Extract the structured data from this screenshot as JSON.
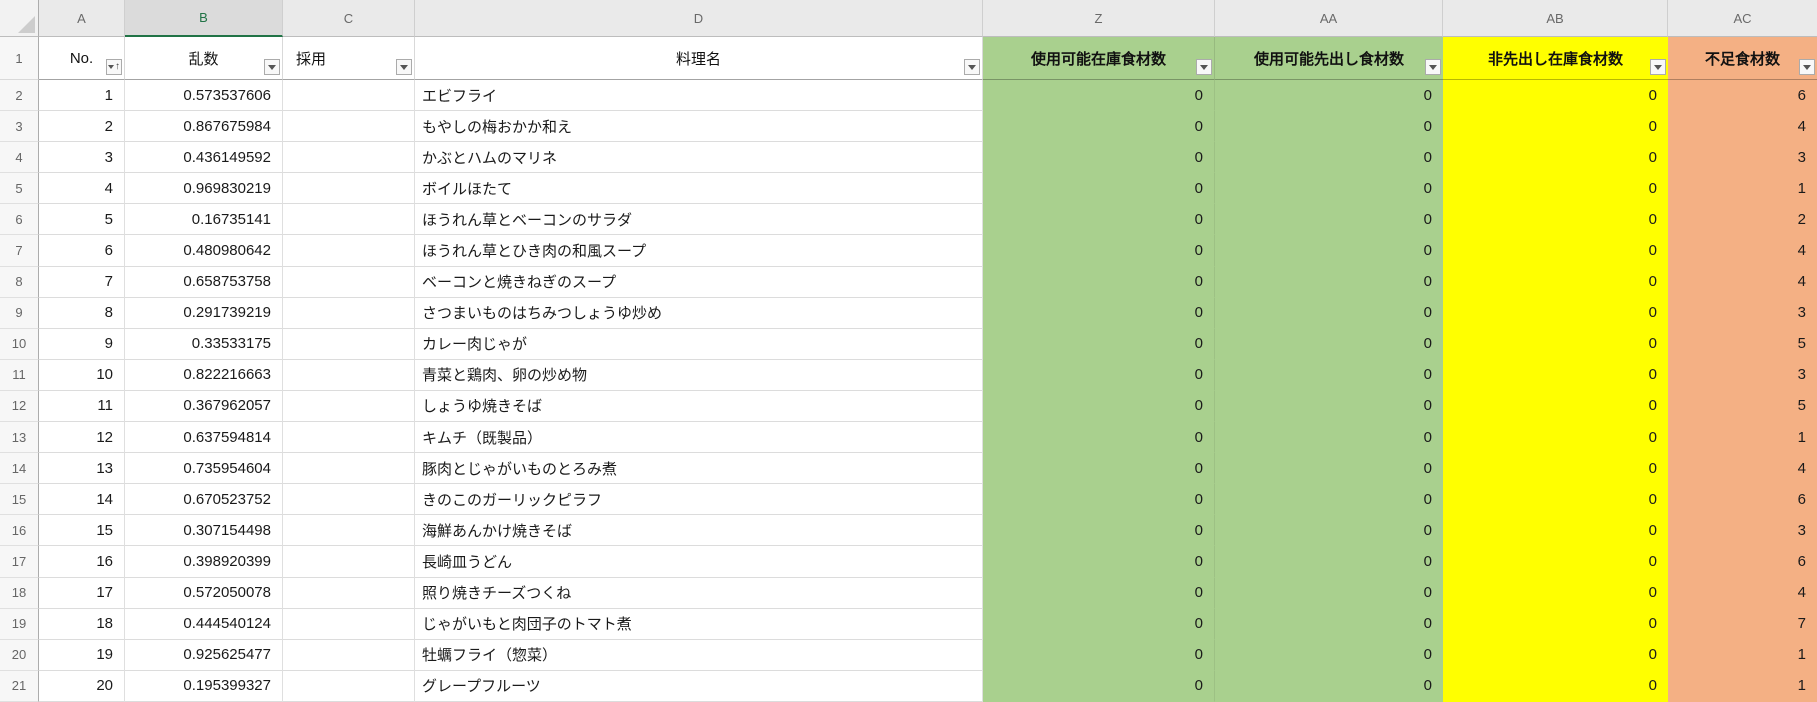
{
  "colors": {
    "green": "#A9D08E",
    "yellow": "#FFFF00",
    "orange": "#F4B084",
    "selected_column_accent": "#217346"
  },
  "sheet": {
    "column_letters": [
      "A",
      "B",
      "C",
      "D",
      "Z",
      "AA",
      "AB",
      "AC"
    ],
    "selected_column_letter": "B",
    "header_row_number": "1"
  },
  "header": {
    "no": "No.",
    "random": "乱数",
    "adopt": "採用",
    "dish": "料理名",
    "available_stock": "使用可能在庫食材数",
    "available_firstout": "使用可能先出し食材数",
    "non_firstout_stock": "非先出し在庫食材数",
    "shortage": "不足食材数"
  },
  "rows": [
    {
      "row": 2,
      "no": 1,
      "random": "0.573537606",
      "adopt": "",
      "dish": "エビフライ",
      "available_stock": 0,
      "available_firstout": 0,
      "non_firstout_stock": 0,
      "shortage": 6
    },
    {
      "row": 3,
      "no": 2,
      "random": "0.867675984",
      "adopt": "",
      "dish": "もやしの梅おかか和え",
      "available_stock": 0,
      "available_firstout": 0,
      "non_firstout_stock": 0,
      "shortage": 4
    },
    {
      "row": 4,
      "no": 3,
      "random": "0.436149592",
      "adopt": "",
      "dish": "かぶとハムのマリネ",
      "available_stock": 0,
      "available_firstout": 0,
      "non_firstout_stock": 0,
      "shortage": 3
    },
    {
      "row": 5,
      "no": 4,
      "random": "0.969830219",
      "adopt": "",
      "dish": "ボイルほたて",
      "available_stock": 0,
      "available_firstout": 0,
      "non_firstout_stock": 0,
      "shortage": 1
    },
    {
      "row": 6,
      "no": 5,
      "random": "0.16735141",
      "adopt": "",
      "dish": "ほうれん草とベーコンのサラダ",
      "available_stock": 0,
      "available_firstout": 0,
      "non_firstout_stock": 0,
      "shortage": 2
    },
    {
      "row": 7,
      "no": 6,
      "random": "0.480980642",
      "adopt": "",
      "dish": "ほうれん草とひき肉の和風スープ",
      "available_stock": 0,
      "available_firstout": 0,
      "non_firstout_stock": 0,
      "shortage": 4
    },
    {
      "row": 8,
      "no": 7,
      "random": "0.658753758",
      "adopt": "",
      "dish": "ベーコンと焼きねぎのスープ",
      "available_stock": 0,
      "available_firstout": 0,
      "non_firstout_stock": 0,
      "shortage": 4
    },
    {
      "row": 9,
      "no": 8,
      "random": "0.291739219",
      "adopt": "",
      "dish": "さつまいものはちみつしょうゆ炒め",
      "available_stock": 0,
      "available_firstout": 0,
      "non_firstout_stock": 0,
      "shortage": 3
    },
    {
      "row": 10,
      "no": 9,
      "random": "0.33533175",
      "adopt": "",
      "dish": "カレー肉じゃが",
      "available_stock": 0,
      "available_firstout": 0,
      "non_firstout_stock": 0,
      "shortage": 5
    },
    {
      "row": 11,
      "no": 10,
      "random": "0.822216663",
      "adopt": "",
      "dish": "青菜と鶏肉、卵の炒め物",
      "available_stock": 0,
      "available_firstout": 0,
      "non_firstout_stock": 0,
      "shortage": 3
    },
    {
      "row": 12,
      "no": 11,
      "random": "0.367962057",
      "adopt": "",
      "dish": "しょうゆ焼きそば",
      "available_stock": 0,
      "available_firstout": 0,
      "non_firstout_stock": 0,
      "shortage": 5
    },
    {
      "row": 13,
      "no": 12,
      "random": "0.637594814",
      "adopt": "",
      "dish": "キムチ（既製品）",
      "available_stock": 0,
      "available_firstout": 0,
      "non_firstout_stock": 0,
      "shortage": 1
    },
    {
      "row": 14,
      "no": 13,
      "random": "0.735954604",
      "adopt": "",
      "dish": "豚肉とじゃがいものとろみ煮",
      "available_stock": 0,
      "available_firstout": 0,
      "non_firstout_stock": 0,
      "shortage": 4
    },
    {
      "row": 15,
      "no": 14,
      "random": "0.670523752",
      "adopt": "",
      "dish": "きのこのガーリックピラフ",
      "available_stock": 0,
      "available_firstout": 0,
      "non_firstout_stock": 0,
      "shortage": 6
    },
    {
      "row": 16,
      "no": 15,
      "random": "0.307154498",
      "adopt": "",
      "dish": "海鮮あんかけ焼きそば",
      "available_stock": 0,
      "available_firstout": 0,
      "non_firstout_stock": 0,
      "shortage": 3
    },
    {
      "row": 17,
      "no": 16,
      "random": "0.398920399",
      "adopt": "",
      "dish": "長崎皿うどん",
      "available_stock": 0,
      "available_firstout": 0,
      "non_firstout_stock": 0,
      "shortage": 6
    },
    {
      "row": 18,
      "no": 17,
      "random": "0.572050078",
      "adopt": "",
      "dish": "照り焼きチーズつくね",
      "available_stock": 0,
      "available_firstout": 0,
      "non_firstout_stock": 0,
      "shortage": 4
    },
    {
      "row": 19,
      "no": 18,
      "random": "0.444540124",
      "adopt": "",
      "dish": "じゃがいもと肉団子のトマト煮",
      "available_stock": 0,
      "available_firstout": 0,
      "non_firstout_stock": 0,
      "shortage": 7
    },
    {
      "row": 20,
      "no": 19,
      "random": "0.925625477",
      "adopt": "",
      "dish": "牡蠣フライ（惣菜）",
      "available_stock": 0,
      "available_firstout": 0,
      "non_firstout_stock": 0,
      "shortage": 1
    },
    {
      "row": 21,
      "no": 20,
      "random": "0.195399327",
      "adopt": "",
      "dish": "グレープフルーツ",
      "available_stock": 0,
      "available_firstout": 0,
      "non_firstout_stock": 0,
      "shortage": 1
    }
  ]
}
